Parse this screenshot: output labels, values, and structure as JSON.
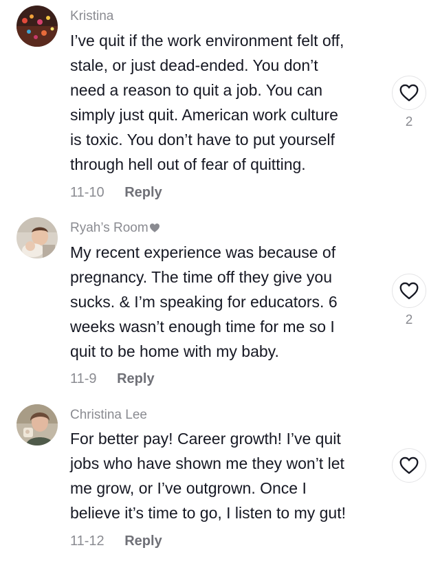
{
  "comments": [
    {
      "username": "Kristina",
      "lines": [
        "I’ve quit if the work environment felt off,",
        "stale, or just dead-ended. You don’t",
        "need a reason to quit a job. You can",
        "simply just quit. American work culture",
        "is toxic. You don’t have to put yourself",
        "through hell out of fear of quitting."
      ],
      "date": "11-10",
      "reply_label": "Reply",
      "like_count": "2",
      "avatar_icon": "avatar-photo-lights"
    },
    {
      "username": "Ryah’s Room",
      "username_badge_icon": "heart-icon",
      "lines": [
        "My recent experience was because of",
        "pregnancy. The time off they give you",
        "sucks. & I’m speaking for educators. 6",
        "weeks wasn’t enough time for me so I",
        "quit to be home with my baby."
      ],
      "date": "11-9",
      "reply_label": "Reply",
      "like_count": "2",
      "avatar_icon": "avatar-photo-baby"
    },
    {
      "username": "Christina Lee",
      "lines": [
        "For better pay! Career growth! I’ve quit",
        "jobs who have shown me they won’t let",
        "me grow, or I’ve outgrown. Once I",
        "believe it’s time to go, I listen to my gut!"
      ],
      "date": "11-12",
      "reply_label": "Reply",
      "like_count": "",
      "avatar_icon": "avatar-photo-person"
    }
  ],
  "colors": {
    "text": "#161823",
    "muted": "#8a8b91",
    "reply": "#6f7077",
    "border": "#e4e4e6"
  }
}
